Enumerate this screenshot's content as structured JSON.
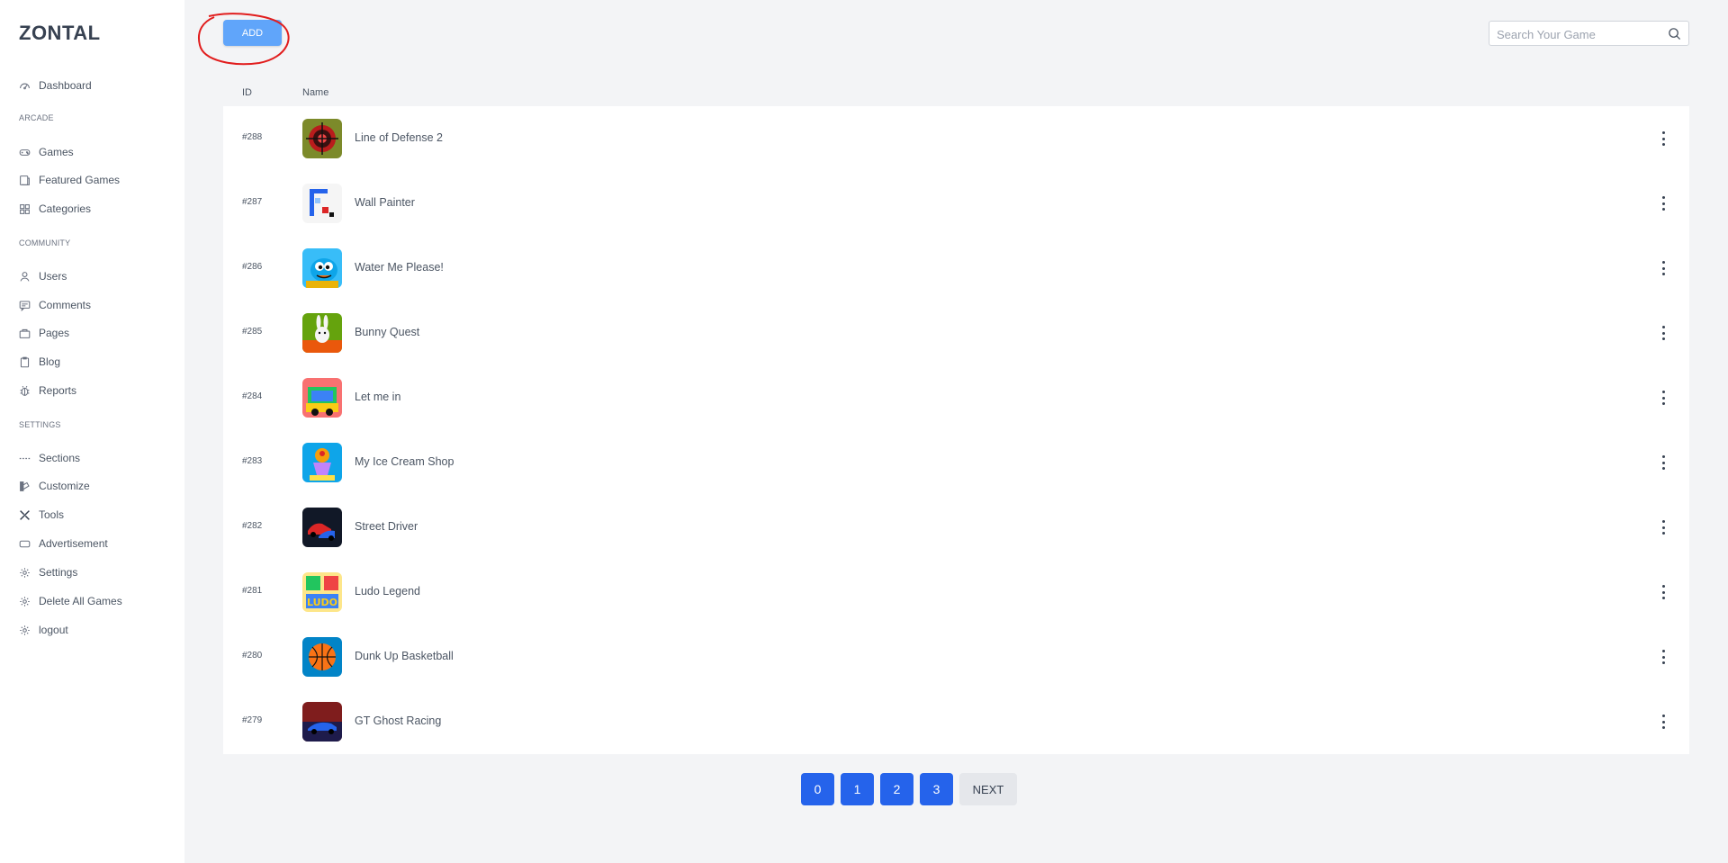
{
  "sidebar": {
    "brand": "ZONTAL",
    "items": [
      {
        "label": "Dashboard",
        "icon": "dashboard-icon"
      },
      {
        "label": "Games",
        "icon": "gamepad-icon"
      },
      {
        "label": "Featured Games",
        "icon": "featured-icon"
      },
      {
        "label": "Categories",
        "icon": "grid-icon"
      },
      {
        "label": "Users",
        "icon": "user-icon"
      },
      {
        "label": "Comments",
        "icon": "comment-icon"
      },
      {
        "label": "Pages",
        "icon": "pages-icon"
      },
      {
        "label": "Blog",
        "icon": "clipboard-icon"
      },
      {
        "label": "Reports",
        "icon": "bug-icon"
      },
      {
        "label": "Sections",
        "icon": "sections-icon"
      },
      {
        "label": "Customize",
        "icon": "customize-icon"
      },
      {
        "label": "Tools",
        "icon": "tools-icon"
      },
      {
        "label": "Advertisement",
        "icon": "ad-icon"
      },
      {
        "label": "Settings",
        "icon": "gear-icon"
      },
      {
        "label": "Delete All Games",
        "icon": "gear-icon"
      },
      {
        "label": "logout",
        "icon": "gear-icon"
      }
    ],
    "sections": {
      "arcade": "ARCADE",
      "community": "COMMUNITY",
      "settings": "SETTINGS"
    }
  },
  "toolbar": {
    "add_label": "ADD",
    "search_placeholder": "Search Your Game"
  },
  "table": {
    "headers": {
      "id": "ID",
      "name": "Name"
    },
    "rows": [
      {
        "id": "#288",
        "name": "Line of Defense 2"
      },
      {
        "id": "#287",
        "name": "Wall Painter"
      },
      {
        "id": "#286",
        "name": "Water Me Please!"
      },
      {
        "id": "#285",
        "name": "Bunny Quest"
      },
      {
        "id": "#284",
        "name": "Let me in"
      },
      {
        "id": "#283",
        "name": "My Ice Cream Shop"
      },
      {
        "id": "#282",
        "name": "Street Driver"
      },
      {
        "id": "#281",
        "name": "Ludo Legend"
      },
      {
        "id": "#280",
        "name": "Dunk Up Basketball"
      },
      {
        "id": "#279",
        "name": "GT Ghost Racing"
      }
    ]
  },
  "pagination": {
    "pages": [
      "0",
      "1",
      "2",
      "3"
    ],
    "next_label": "NEXT"
  },
  "colors": {
    "accent_add": "#60a5fa",
    "page_button": "#2563eb",
    "highlight_circle": "#e11d1d"
  }
}
